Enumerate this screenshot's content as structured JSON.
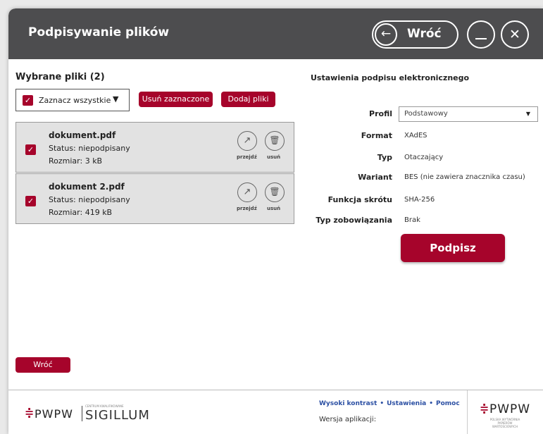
{
  "header": {
    "title": "Podpisywanie plików",
    "back_label": "Wróć",
    "back_icon": "arrow-left-icon",
    "minimize_icon": "minimize-icon",
    "close_icon": "close-icon"
  },
  "files_panel": {
    "heading": "Wybrane pliki (2)",
    "select_all_label": "Zaznacz wszystkie",
    "remove_selected_label": "Usuń zaznaczone",
    "add_files_label": "Dodaj pliki",
    "go_label": "przejdź",
    "delete_label": "usuń",
    "files": [
      {
        "name": "dokument.pdf",
        "status": "Status: niepodpisany",
        "size": "Rozmiar: 3 kB",
        "checked": true
      },
      {
        "name": "dokument 2.pdf",
        "status": "Status: niepodpisany",
        "size": "Rozmiar: 419 kB",
        "checked": true
      }
    ]
  },
  "settings": {
    "heading": "Ustawienia podpisu elektronicznego",
    "rows": [
      {
        "label": "Profil",
        "value": "Podstawowy"
      },
      {
        "label": "Format",
        "value": "XAdES"
      },
      {
        "label": "Typ",
        "value": "Otaczający"
      },
      {
        "label": "Wariant",
        "value": "BES (nie zawiera znacznika czasu)"
      },
      {
        "label": "Funkcja skrótu",
        "value": "SHA-256"
      },
      {
        "label": "Typ zobowiązania",
        "value": "Brak"
      }
    ],
    "sign_label": "Podpisz"
  },
  "footer": {
    "back_label": "Wróć",
    "links": [
      "Wysoki kontrast",
      "Ustawienia",
      "Pomoc"
    ],
    "version_label": "Wersja aplikacji:",
    "logo_left": {
      "mark": "PWPW",
      "small": "CENTRUM KWALIFIKOWANE",
      "name": "SIGILLUM"
    },
    "logo_right": {
      "mark": "PWPW",
      "sub": "POLSKA WYTWÓRNIA PAPIERÓW WARTOŚCIOWYCH"
    }
  },
  "colors": {
    "accent": "#a6042b",
    "header_bg": "#4d4d4f",
    "link": "#2b4fa3"
  }
}
